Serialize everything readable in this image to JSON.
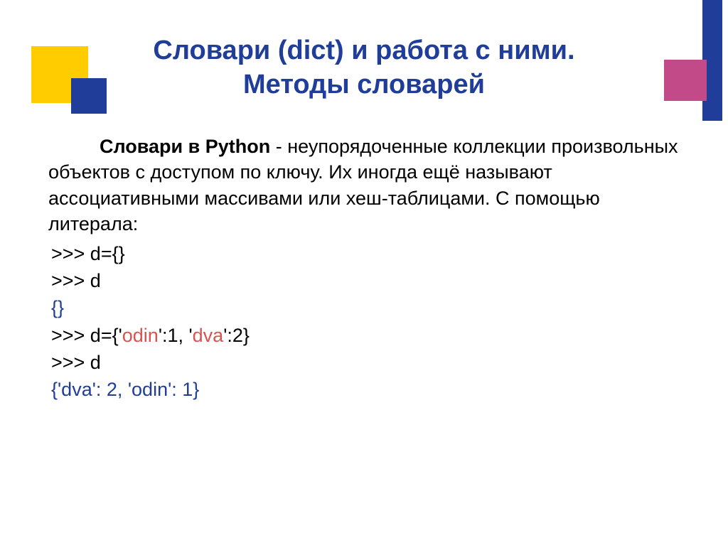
{
  "title_line1": "Словари (dict) и работа с ними.",
  "title_line2": "Методы словарей",
  "para_strong": "Словари в Python",
  "para_rest": " - неупорядоченные коллекции произвольных объектов с доступом по ключу. Их иногда ещё называют ассоциативными массивами или хеш-таблицами. С помощью литерала:",
  "code": {
    "l1": ">>> d={}",
    "l2": ">>> d",
    "l3": "{}",
    "l4_a": ">>> d={'",
    "l4_b": "odin",
    "l4_c": "':1, '",
    "l4_d": "dva",
    "l4_e": "':2}",
    "l5": ">>> d",
    "l6": "{'dva': 2, 'odin': 1}"
  }
}
